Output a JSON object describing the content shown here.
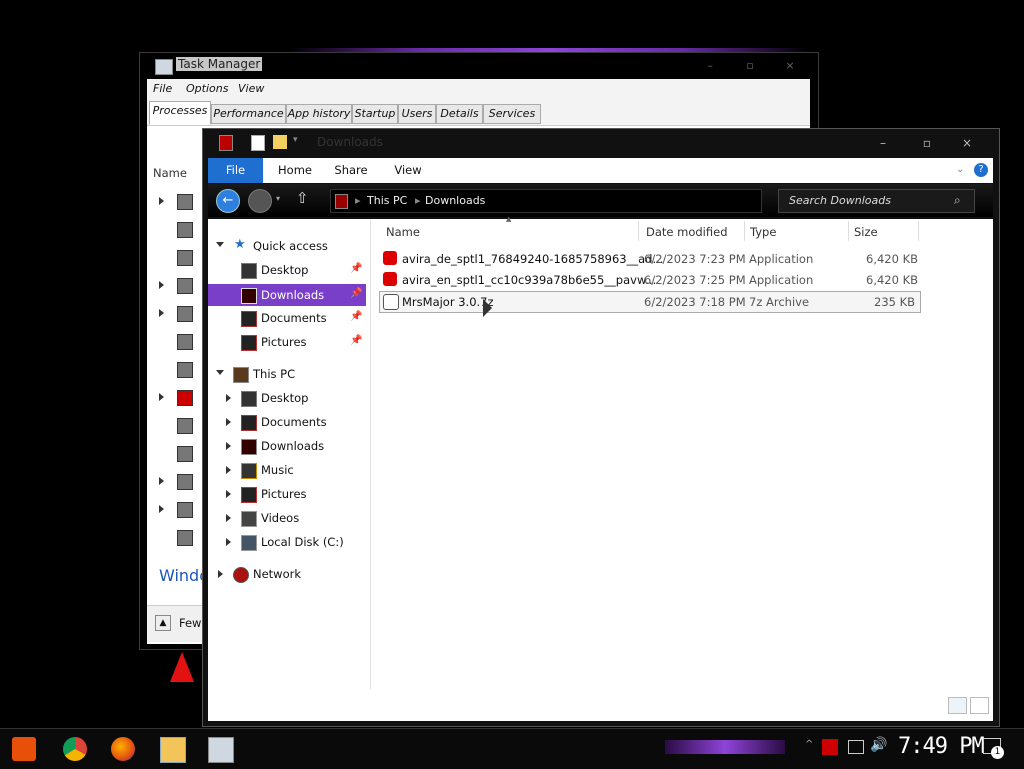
{
  "task_manager": {
    "title": "Task Manager",
    "controls": [
      "–",
      "▫",
      "×"
    ],
    "menu": [
      "File",
      "Options",
      "View"
    ],
    "tabs": [
      "Processes",
      "Performance",
      "App history",
      "Startup",
      "Users",
      "Details",
      "Services"
    ],
    "active_tab": "Processes",
    "column_name": "Name",
    "windows_label_partial": "Windo",
    "fewer_details_partial": "Few"
  },
  "explorer": {
    "title": "Downloads",
    "controls": [
      "–",
      "▫",
      "×"
    ],
    "ribbon_tabs": [
      "File",
      "Home",
      "Share",
      "View"
    ],
    "breadcrumb": [
      "This PC",
      "Downloads"
    ],
    "search_placeholder": "Search Downloads",
    "nav": {
      "quick_access": "Quick access",
      "quick_items": [
        "Desktop",
        "Downloads",
        "Documents",
        "Pictures"
      ],
      "this_pc": "This PC",
      "pc_items": [
        "Desktop",
        "Documents",
        "Downloads",
        "Music",
        "Pictures",
        "Videos",
        "Local Disk (C:)"
      ],
      "network": "Network"
    },
    "columns": [
      "Name",
      "Date modified",
      "Type",
      "Size"
    ],
    "files": [
      {
        "name": "avira_de_sptl1_76849240-1685758963__ad...",
        "date": "6/2/2023 7:23 PM",
        "type": "Application",
        "size": "6,420 KB"
      },
      {
        "name": "avira_en_sptl1_cc10c939a78b6e55__pavw...",
        "date": "6/2/2023 7:25 PM",
        "type": "Application",
        "size": "6,420 KB"
      },
      {
        "name": "MrsMajor 3.0.7z",
        "date": "6/2/2023 7:18 PM",
        "type": "7z Archive",
        "size": "235 KB"
      }
    ]
  },
  "taskbar": {
    "clock": "7:49 PM",
    "notification_count": "1"
  }
}
